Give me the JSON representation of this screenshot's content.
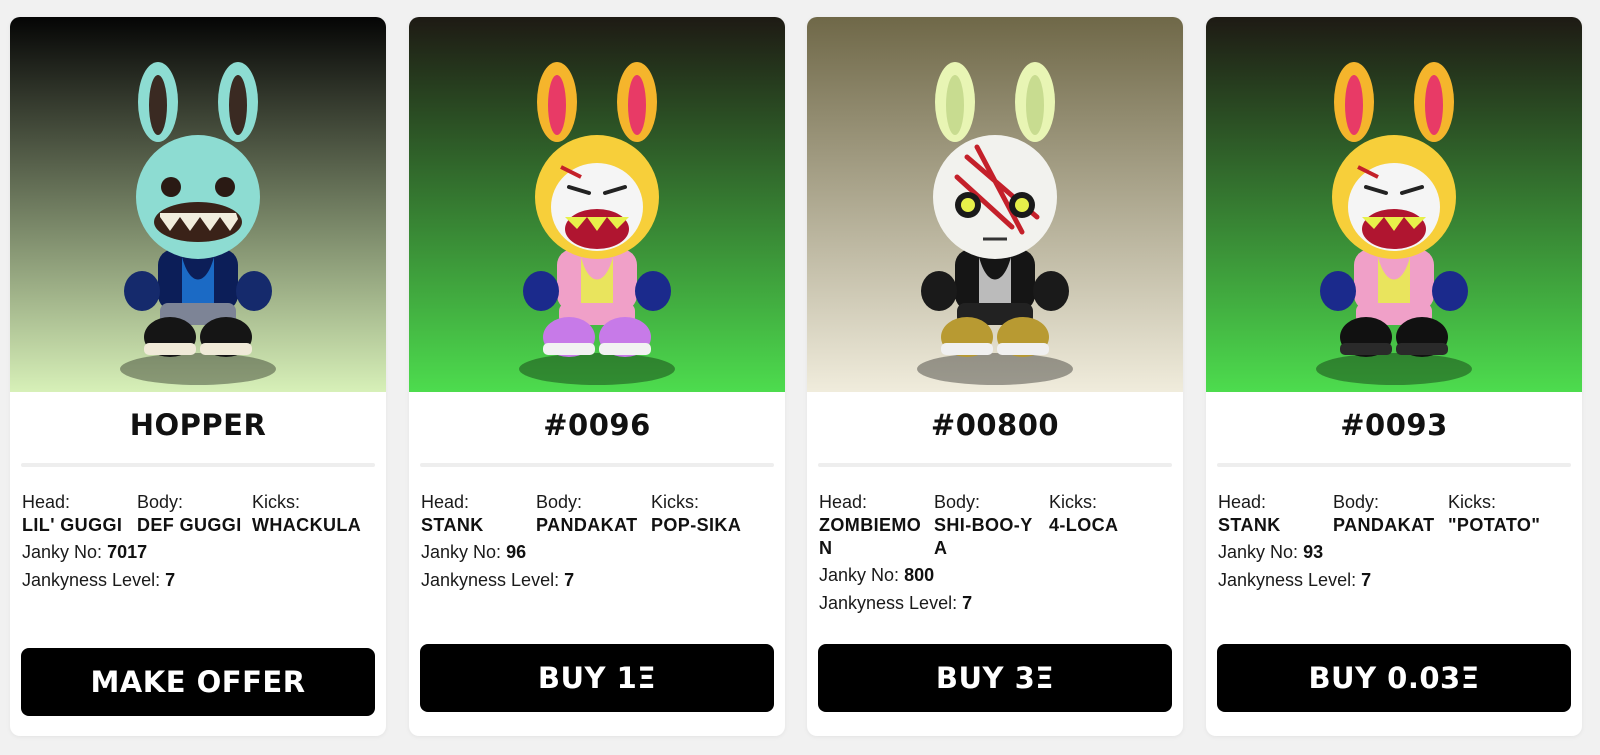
{
  "labels": {
    "head": "Head:",
    "body": "Body:",
    "kicks": "Kicks:",
    "janky_no": "Janky No:",
    "jankyness_level": "Jankyness Level:"
  },
  "cards": [
    {
      "title": "HOPPER",
      "head": "LIL' GUGGI",
      "body": "DEF GUGGI",
      "kicks": "WHACKULA",
      "janky_no": "7017",
      "jankyness_level": "7",
      "button": "MAKE OFFER",
      "figure": {
        "bg_top": "#050505",
        "bg_bottom": "#d7f0b8",
        "ear": "#8ddcd2",
        "ear_inner": "#3a2a22",
        "head": "#8ddcd2",
        "face": "monster-grin",
        "torso": "#0c1e58",
        "torso_accent": "#1e78d8",
        "arms": "#152a6c",
        "legs": "#7d8496",
        "shoes": "#151515",
        "sole": "#f0ead8"
      }
    },
    {
      "title": "#0096",
      "head": "STANK",
      "body": "PANDAKAT",
      "kicks": "POP-SIKA",
      "janky_no": "96",
      "jankyness_level": "7",
      "button": "BUY 1Ξ",
      "figure": {
        "bg_top": "#1e1a14",
        "bg_bottom": "#4ddc4e",
        "ear": "#f5b52c",
        "ear_inner": "#e83a66",
        "head": "#f7cf3a",
        "face": "skull-mask",
        "torso": "#f0a0c8",
        "torso_accent": "#e8f04a",
        "arms": "#1b2a8c",
        "legs": "#f0a0c8",
        "shoes": "#c77ae8",
        "sole": "#f2f2f2"
      }
    },
    {
      "title": "#00800",
      "head": "ZOMBIEMON",
      "body": "SHI-BOO-YA",
      "kicks": "4-LOCA",
      "janky_no": "800",
      "jankyness_level": "7",
      "button": "BUY 3Ξ",
      "figure": {
        "bg_top": "#6f6848",
        "bg_bottom": "#f0ecdc",
        "ear": "#e8f5b4",
        "ear_inner": "#c8dc90",
        "head": "#f2f2ee",
        "face": "zombie",
        "torso": "#151515",
        "torso_accent": "#d8d8d8",
        "arms": "#1a1a1a",
        "legs": "#222222",
        "shoes": "#b89a32",
        "sole": "#f0f0f0"
      }
    },
    {
      "title": "#0093",
      "head": "STANK",
      "body": "PANDAKAT",
      "kicks": "\"POTATO\"",
      "janky_no": "93",
      "jankyness_level": "7",
      "button": "BUY 0.03Ξ",
      "figure": {
        "bg_top": "#1e1a14",
        "bg_bottom": "#4ddc4e",
        "ear": "#f5b52c",
        "ear_inner": "#e83a66",
        "head": "#f7cf3a",
        "face": "skull-mask",
        "torso": "#f0a0c8",
        "torso_accent": "#e8f04a",
        "arms": "#1b2a8c",
        "legs": "#f0a0c8",
        "shoes": "#111111",
        "sole": "#2a2a2a"
      }
    }
  ]
}
